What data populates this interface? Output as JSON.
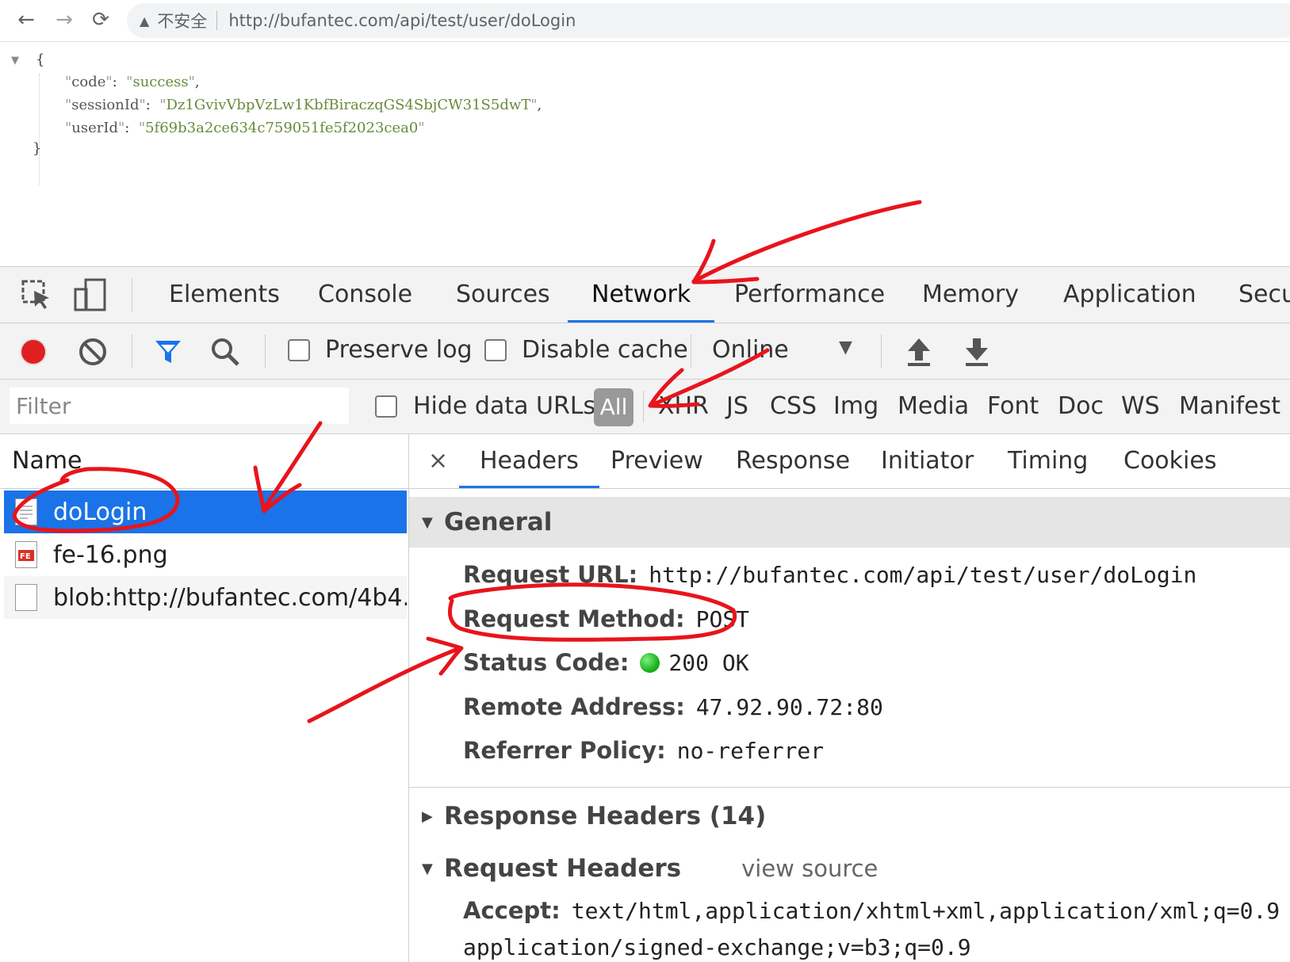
{
  "browser": {
    "nav": [
      "←",
      "→",
      "⟳"
    ],
    "security_label": "不安全",
    "url": "http://bufantec.com/api/test/user/doLogin"
  },
  "json_view": {
    "open_brace": "{",
    "close_brace": "}",
    "fields": [
      {
        "key": "code",
        "value": "success",
        "comma": ","
      },
      {
        "key": "sessionId",
        "value": "Dz1GvivVbpVzLw1KbfBiraczqGS4SbjCW31S5dwT",
        "comma": ","
      },
      {
        "key": "userId",
        "value": "5f69b3a2ce634c759051fe5f2023cea0",
        "comma": ""
      }
    ]
  },
  "devtools": {
    "main_tabs": [
      "Elements",
      "Console",
      "Sources",
      "Network",
      "Performance",
      "Memory",
      "Application",
      "Secu"
    ],
    "active_tab": "Network",
    "toolbar": {
      "preserve_log": "Preserve log",
      "disable_cache": "Disable cache",
      "throttle": "Online",
      "throttle_arrow": "▼"
    },
    "filter": {
      "placeholder": "Filter",
      "hide_data_urls": "Hide data URLs",
      "types": [
        "All",
        "XHR",
        "JS",
        "CSS",
        "Img",
        "Media",
        "Font",
        "Doc",
        "WS",
        "Manifest"
      ],
      "active_type": "All"
    },
    "request_list": {
      "header": "Name",
      "rows": [
        "doLogin",
        "fe-16.png",
        "blob:http://bufantec.com/4b4..."
      ]
    },
    "details": {
      "close": "×",
      "tabs": [
        "Headers",
        "Preview",
        "Response",
        "Initiator",
        "Timing",
        "Cookies"
      ],
      "active_tab": "Headers",
      "general_title": "General",
      "general": [
        {
          "key": "Request URL:",
          "value": "http://bufantec.com/api/test/user/doLogin"
        },
        {
          "key": "Request Method:",
          "value": "POST"
        },
        {
          "key": "Status Code:",
          "value": "200 OK"
        },
        {
          "key": "Remote Address:",
          "value": "47.92.90.72:80"
        },
        {
          "key": "Referrer Policy:",
          "value": "no-referrer"
        }
      ],
      "response_headers_title": "Response Headers (14)",
      "request_headers_title": "Request Headers",
      "view_source": "view source",
      "request_headers": [
        {
          "key": "Accept:",
          "value": "text/html,application/xhtml+xml,application/xml;q=0.9"
        }
      ],
      "request_headers_cont": "application/signed-exchange;v=b3;q=0.9"
    },
    "colors": {
      "accent": "#1a73e8",
      "record": "#e02020",
      "status_ok": "#1db31d",
      "annotation": "#e8141c"
    }
  }
}
